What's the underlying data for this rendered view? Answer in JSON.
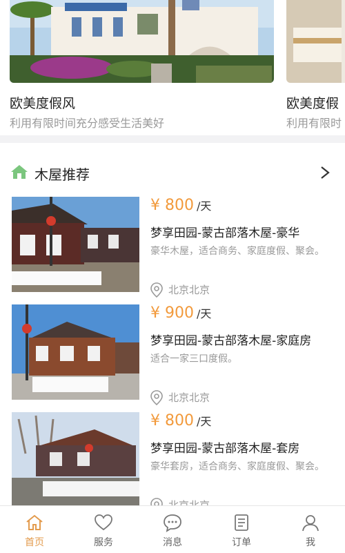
{
  "carousel": [
    {
      "title": "欧美度假风",
      "subtitle": "利用有限时间充分感受生活美好"
    },
    {
      "title": "欧美度假",
      "subtitle": "利用有限时"
    }
  ],
  "section": {
    "title": "木屋推荐"
  },
  "listings": [
    {
      "currency": "¥",
      "price": "800",
      "unit": "/天",
      "name": "梦享田园-蒙古部落木屋-豪华",
      "desc": "豪华木屋，适合商务、家庭度假、聚会。",
      "location": "北京北京"
    },
    {
      "currency": "¥",
      "price": "900",
      "unit": "/天",
      "name": "梦享田园-蒙古部落木屋-家庭房",
      "desc": "适合一家三口度假。",
      "location": "北京北京"
    },
    {
      "currency": "¥",
      "price": "800",
      "unit": "/天",
      "name": "梦享田园-蒙古部落木屋-套房",
      "desc": "豪华套房，适合商务、家庭度假、聚会。",
      "location": "北京北京"
    }
  ],
  "tabs": [
    {
      "label": "首页",
      "icon": "home-icon",
      "active": true
    },
    {
      "label": "服务",
      "icon": "heart-icon",
      "active": false
    },
    {
      "label": "消息",
      "icon": "chat-icon",
      "active": false
    },
    {
      "label": "订单",
      "icon": "order-icon",
      "active": false
    },
    {
      "label": "我",
      "icon": "user-icon",
      "active": false
    }
  ],
  "colors": {
    "accent": "#f29a3c",
    "active_tab": "#e39b4d",
    "house_icon": "#7bc67e"
  }
}
